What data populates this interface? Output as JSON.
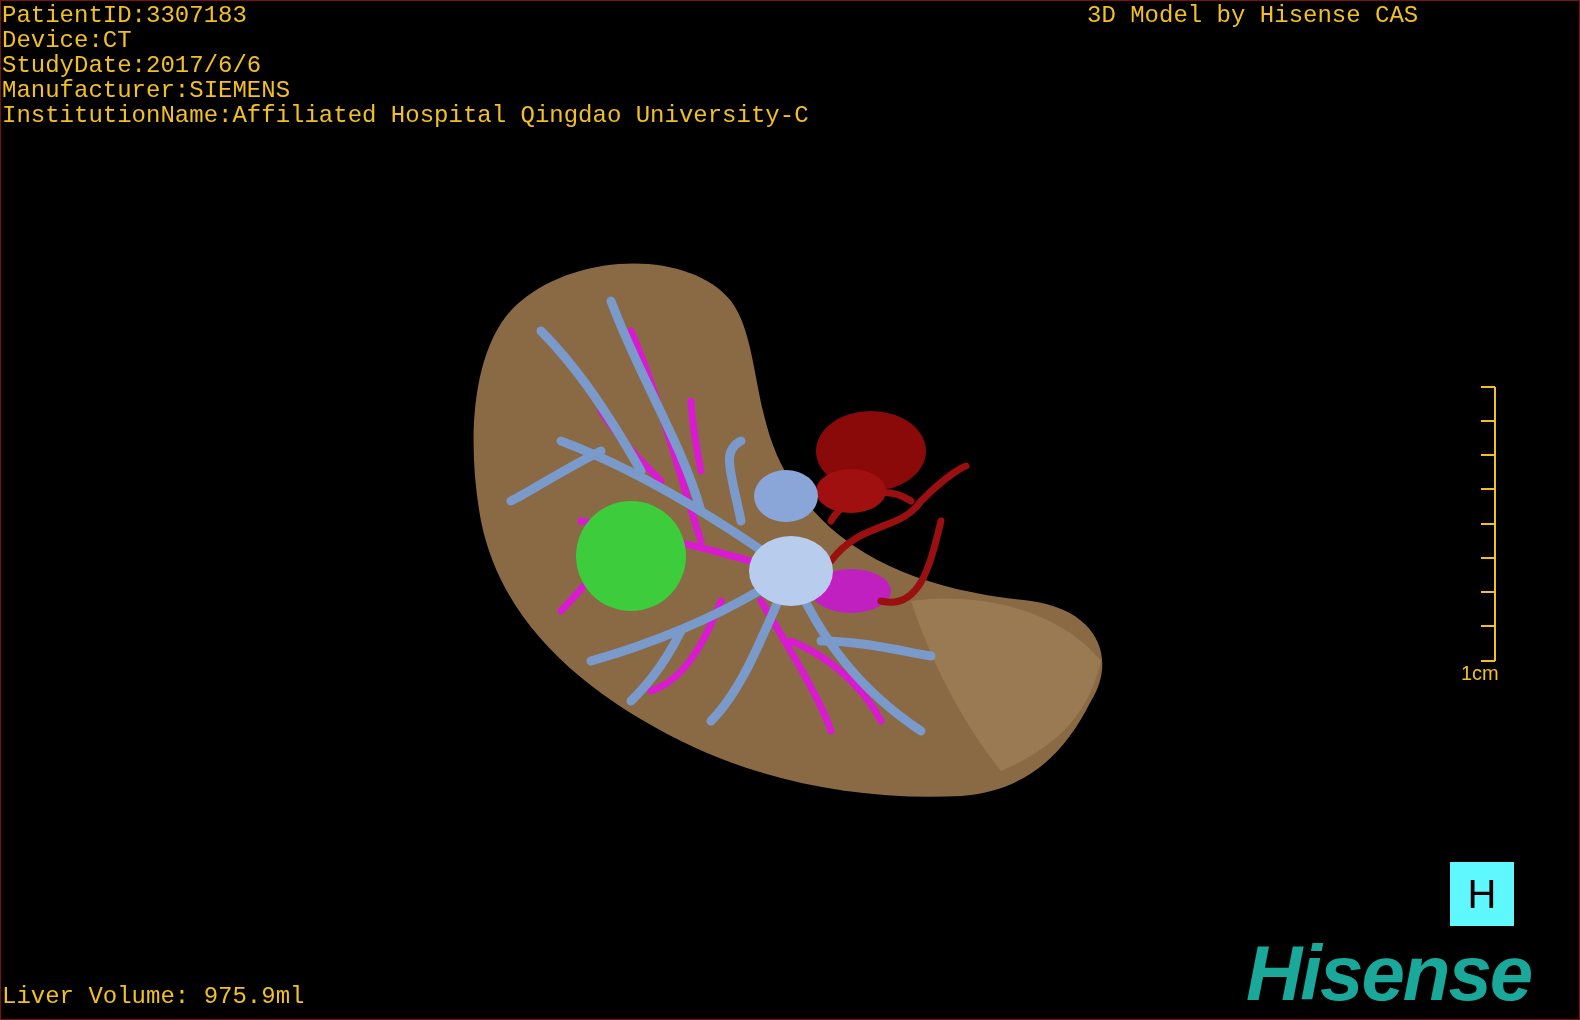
{
  "patient_info": [
    "PatientID:3307183",
    "Device:CT",
    "StudyDate:2017/6/6",
    "Manufacturer:SIEMENS",
    "InstitutionName:Affiliated Hospital Qingdao University-C"
  ],
  "title": "3D Model by Hisense CAS",
  "scale_bar": {
    "label": "1cm"
  },
  "view_button": "H",
  "liver_volume": "Liver Volume: 975.9ml",
  "logo": "Hisense"
}
